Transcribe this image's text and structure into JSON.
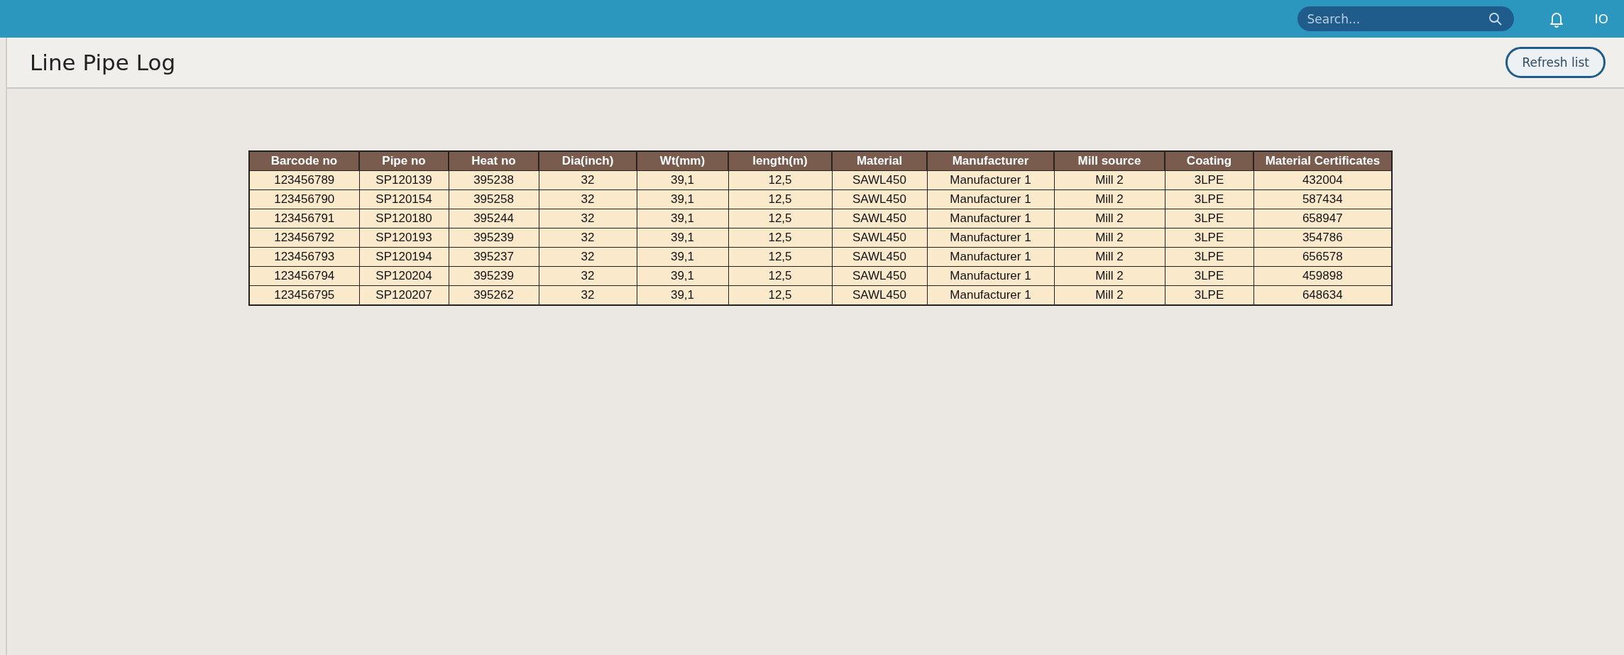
{
  "top_bar": {
    "search": {
      "placeholder": "Search..."
    },
    "user_initials": "IO"
  },
  "page": {
    "title": "Line Pipe Log",
    "refresh_button": "Refresh list"
  },
  "table": {
    "columns": [
      "Barcode no",
      "Pipe no",
      "Heat no",
      "Dia(inch)",
      "Wt(mm)",
      "length(m)",
      "Material",
      "Manufacturer",
      "Mill source",
      "Coating",
      "Material Certificates"
    ],
    "rows": [
      [
        "123456789",
        "SP120139",
        "395238",
        "32",
        "39,1",
        "12,5",
        "SAWL450",
        "Manufacturer 1",
        "Mill 2",
        "3LPE",
        "432004"
      ],
      [
        "123456790",
        "SP120154",
        "395258",
        "32",
        "39,1",
        "12,5",
        "SAWL450",
        "Manufacturer 1",
        "Mill 2",
        "3LPE",
        "587434"
      ],
      [
        "123456791",
        "SP120180",
        "395244",
        "32",
        "39,1",
        "12,5",
        "SAWL450",
        "Manufacturer 1",
        "Mill 2",
        "3LPE",
        "658947"
      ],
      [
        "123456792",
        "SP120193",
        "395239",
        "32",
        "39,1",
        "12,5",
        "SAWL450",
        "Manufacturer 1",
        "Mill 2",
        "3LPE",
        "354786"
      ],
      [
        "123456793",
        "SP120194",
        "395237",
        "32",
        "39,1",
        "12,5",
        "SAWL450",
        "Manufacturer 1",
        "Mill 2",
        "3LPE",
        "656578"
      ],
      [
        "123456794",
        "SP120204",
        "395239",
        "32",
        "39,1",
        "12,5",
        "SAWL450",
        "Manufacturer 1",
        "Mill 2",
        "3LPE",
        "459898"
      ],
      [
        "123456795",
        "SP120207",
        "395262",
        "32",
        "39,1",
        "12,5",
        "SAWL450",
        "Manufacturer 1",
        "Mill 2",
        "3LPE",
        "648634"
      ]
    ]
  }
}
